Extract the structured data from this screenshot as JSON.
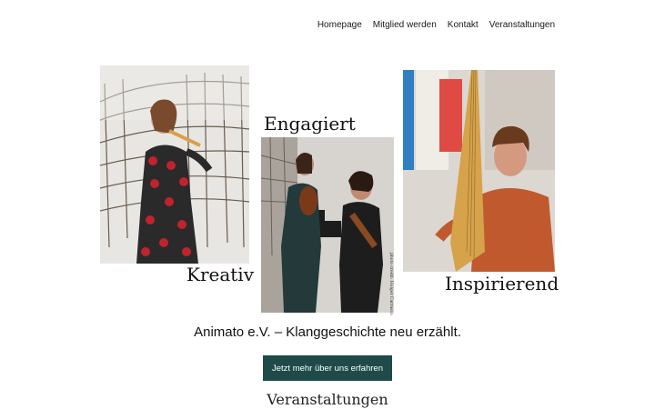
{
  "nav": {
    "items": [
      "Homepage",
      "Mitglied werden",
      "Kontakt",
      "Veranstaltungen"
    ]
  },
  "hero": {
    "words": {
      "left": "Kreativ",
      "center": "Engagiert",
      "right": "Inspirierend"
    },
    "photo_credit": "photo credit: Holger Carrasco",
    "tagline": "Animato e.V. – Klanggeschichte neu erzählt.",
    "cta_label": "Jetzt mehr über uns erfahren"
  },
  "section": {
    "heading": "Veranstaltungen"
  },
  "colors": {
    "accent": "#1f4a4a",
    "background": "#ffffff",
    "text": "#1a1a1a"
  }
}
